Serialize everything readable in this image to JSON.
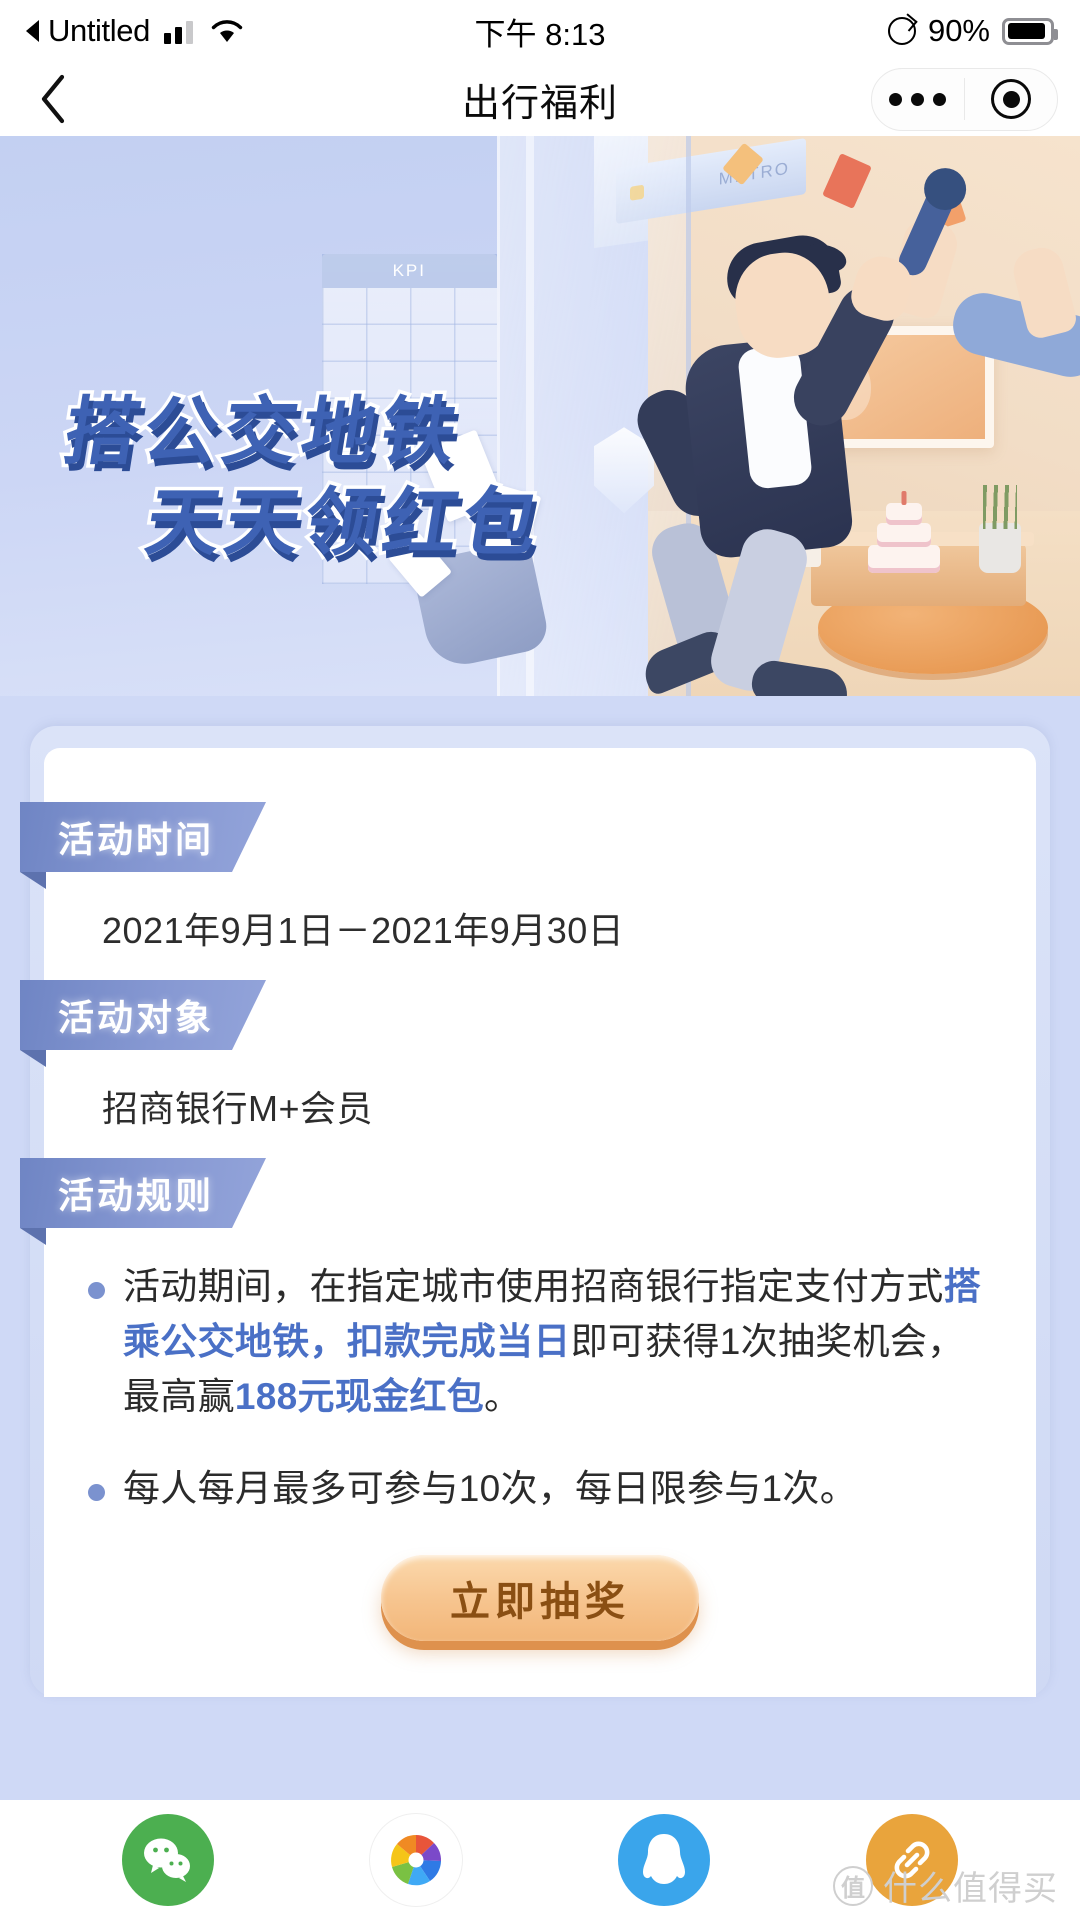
{
  "statusbar": {
    "carrier": "Untitled",
    "time": "下午 8:13",
    "battery_percent": "90%",
    "signal_icon": "signal-bars-icon",
    "wifi_icon": "wifi-icon",
    "rotation_lock_icon": "rotation-lock-icon",
    "battery_icon": "battery-icon",
    "back_arrow_icon": "back-triangle-icon"
  },
  "navbar": {
    "back_icon": "chevron-left-icon",
    "title": "出行福利",
    "menu_icon": "more-dots-icon",
    "target_icon": "target-circle-icon"
  },
  "hero": {
    "line1": "搭公交地铁",
    "line2": "天天领红包",
    "kpi_label": "KPI",
    "metro_label": "METRO",
    "title_color": "#3e62b4",
    "title_shadow_color": "#2c4c96"
  },
  "card": {
    "sections": [
      {
        "label": "活动时间",
        "text": "2021年9月1日－2021年9月30日"
      },
      {
        "label": "活动对象",
        "text": "招商银行M+会员"
      },
      {
        "label": "活动规则",
        "text": ""
      }
    ],
    "rules": [
      {
        "parts": [
          {
            "t": "活动期间，在指定城市使用招商银行指定支付方式",
            "hl": false
          },
          {
            "t": "搭乘公交地铁，扣款完成当日",
            "hl": true
          },
          {
            "t": "即可获得1次抽奖机会，最高赢",
            "hl": false
          },
          {
            "t": "188元现金红包",
            "hl": true
          },
          {
            "t": "。",
            "hl": false
          }
        ]
      },
      {
        "parts": [
          {
            "t": "每人每月最多可参与10次，每日限参与1次。",
            "hl": false
          }
        ]
      }
    ],
    "cta_label": "立即抽奖",
    "highlight_color": "#4a70c6",
    "ribbon_color": "#8698d2",
    "cta_color": "#f7c691"
  },
  "sharebar": {
    "items": [
      {
        "name": "wechat",
        "icon": "wechat-icon",
        "color": "#4caf50"
      },
      {
        "name": "moments",
        "icon": "wechat-moments-icon",
        "color": "#ffffff"
      },
      {
        "name": "qq",
        "icon": "qq-icon",
        "color": "#3aa5eb"
      },
      {
        "name": "copy-link",
        "icon": "link-icon",
        "color": "#e9a43c"
      }
    ]
  },
  "watermark": {
    "mark": "值",
    "text": "什么值得买"
  }
}
